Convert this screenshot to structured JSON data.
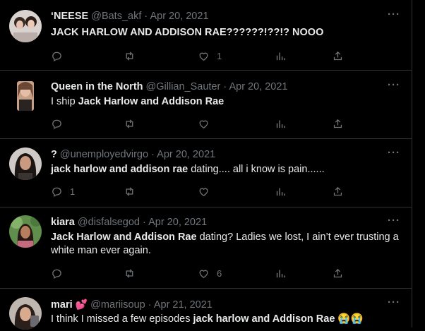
{
  "tweets": [
    {
      "name": "‘NEESE",
      "handle": "@Bats_akf",
      "sep": "·",
      "date": "Apr 20, 2021",
      "body": [
        {
          "b": true,
          "t": "JACK HARLOW AND ADDISON RAE??????!??!? NOOO"
        }
      ],
      "reply_count": "",
      "like_count": "1"
    },
    {
      "name": "Queen in the North",
      "handle": "@Gillian_Sauter",
      "sep": "·",
      "date": "Apr 20, 2021",
      "body": [
        {
          "b": false,
          "t": "I ship "
        },
        {
          "b": true,
          "t": "Jack Harlow and Addison Rae"
        }
      ],
      "reply_count": "",
      "like_count": ""
    },
    {
      "name": "?",
      "handle": "@unemployedvirgo",
      "sep": "·",
      "date": "Apr 20, 2021",
      "body": [
        {
          "b": true,
          "t": "jack harlow and addison rae"
        },
        {
          "b": false,
          "t": " dating.... all i know is pain......"
        }
      ],
      "reply_count": "1",
      "like_count": ""
    },
    {
      "name": "kiara",
      "handle": "@disfalsegod",
      "sep": "·",
      "date": "Apr 20, 2021",
      "body": [
        {
          "b": true,
          "t": "Jack Harlow and Addison Rae"
        },
        {
          "b": false,
          "t": " dating? Ladies we lost, I ain’t ever trusting a white man ever again."
        }
      ],
      "reply_count": "",
      "like_count": "6"
    },
    {
      "name": "mari",
      "name_emoji": "💕",
      "handle": "@mariisoup",
      "sep": "·",
      "date": "Apr 21, 2021",
      "body": [
        {
          "b": false,
          "t": "I think I missed a few episodes "
        },
        {
          "b": true,
          "t": "jack harlow and Addison Rae"
        },
        {
          "b": false,
          "t": " 😭😭"
        }
      ],
      "reply_count": "",
      "like_count": ""
    }
  ],
  "more_label": "···",
  "icons": {
    "reply": "reply-icon",
    "retweet": "retweet-icon",
    "like": "like-icon",
    "views": "views-icon",
    "share": "share-icon",
    "more": "more-icon"
  },
  "colors": {
    "background": "#000000",
    "text": "#e7e9ea",
    "muted": "#71767b",
    "divider": "#2f3336"
  }
}
